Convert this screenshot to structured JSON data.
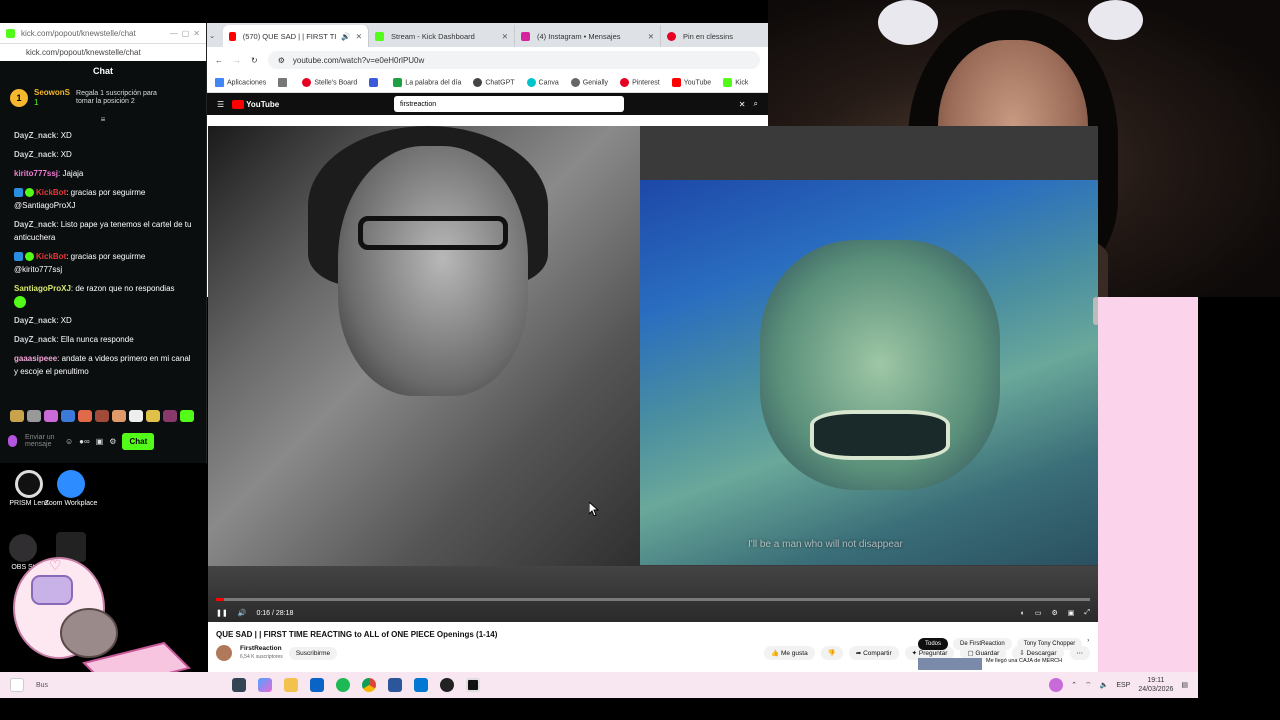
{
  "chat_window": {
    "tab_url": "kick.com/popout/knewstelle/chat",
    "url": "kick.com/popout/knewstelle/chat",
    "header": "Chat",
    "pinned": {
      "rank": "1",
      "user": "SeowonS",
      "sub_count": "1",
      "text": "Regala 1 suscripción para tomar la posición 2"
    },
    "messages": [
      {
        "user": "DayZ_nack",
        "text": ": XD"
      },
      {
        "user": "DayZ_nack",
        "text": ": XD"
      },
      {
        "user": "kirito777ssj",
        "text": ": Jajaja"
      },
      {
        "user": "KickBot",
        "text": ": gracias por seguirme @SantiagoProXJ"
      },
      {
        "user": "DayZ_nack",
        "text": ": Listo pape ya tenemos el cartel de tu anticuchera"
      },
      {
        "user": "KickBot",
        "text": ": gracias por seguirme @kirito777ssj"
      },
      {
        "user": "SantiagoProXJ",
        "text": ": de razon que no respondias"
      },
      {
        "user": "DayZ_nack",
        "text": ": XD"
      },
      {
        "user": "DayZ_nack",
        "text": ": Ella nunca responde"
      },
      {
        "user": "gaaasipeee",
        "text": ": andate a videos primero en mi canal y escoje el penultimo"
      }
    ],
    "input_placeholder": "Enviar un mensaje",
    "send_label": "Chat"
  },
  "desktop_icons": [
    {
      "label": "PRISM Lens"
    },
    {
      "label": "Zoom Workplace"
    },
    {
      "label": "OBS St"
    }
  ],
  "browser": {
    "tabs": [
      {
        "label": "(570) QUE SAD | | FIRST TI",
        "active": true
      },
      {
        "label": "Stream - Kick Dashboard",
        "active": false
      },
      {
        "label": "(4) Instagram • Mensajes",
        "active": false
      },
      {
        "label": "Pin en clessins",
        "active": false
      }
    ],
    "url": "youtube.com/watch?v=e0eH0rlPU0w",
    "bookmarks": [
      "Aplicaciones",
      "Stelle's Board",
      "La palabra del día",
      "ChatGPT",
      "Genially",
      "Pinterest",
      "YouTube",
      "Kick"
    ],
    "search_query": "firstreaction",
    "yt_logo": "YouTube"
  },
  "video": {
    "time": "0:16 / 28:18",
    "progress": 0.0094,
    "subtitle": "I'll be a man who will not disappear"
  },
  "yt_info": {
    "title": "QUE SAD | | FIRST TIME REACTING to ALL of ONE PIECE Openings (1-14)",
    "channel": "FirstReaction",
    "subs": "6,54 K suscriptores",
    "subscribe": "Suscribirme",
    "like": "Me gusta",
    "share": "Compartir",
    "ask": "Preguntar",
    "save": "Guardar",
    "download": "Descargar",
    "chips": [
      "Todos",
      "De FirstReaction",
      "Tony Tony Chopper"
    ],
    "related": "Me llegó una CAJA de MERCH"
  },
  "taskbar": {
    "lang": "ESP",
    "time": "19:11",
    "date": "24/03/2026",
    "search_label": "Bus"
  },
  "colors": {
    "kick_green": "#53fc18",
    "yt_red": "#ff0000",
    "pink_bg": "#fbd3ea"
  }
}
